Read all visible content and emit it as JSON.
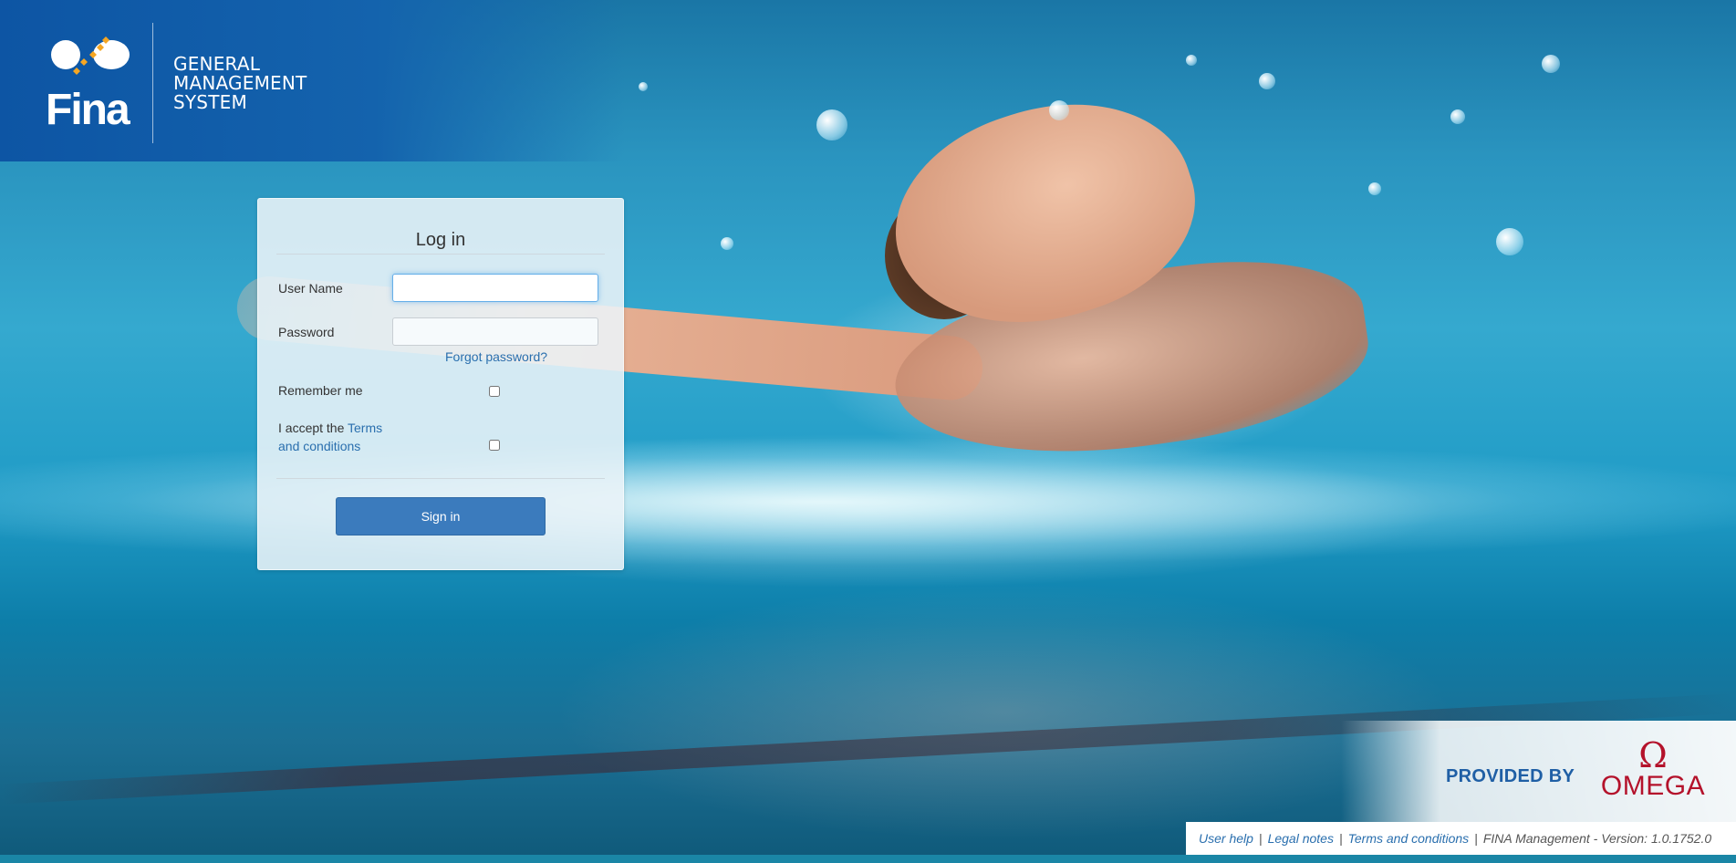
{
  "header": {
    "logo_text": "Fina",
    "title_lines": [
      "GENERAL",
      "MANAGEMENT",
      "SYSTEM"
    ],
    "brand_color": "#0d55a4"
  },
  "login": {
    "title": "Log in",
    "username_label": "User Name",
    "username_value": "",
    "password_label": "Password",
    "password_value": "",
    "forgot_link": "Forgot password?",
    "remember_label": "Remember me",
    "remember_checked": false,
    "accept_prefix": "I accept the ",
    "accept_link": "Terms and conditions",
    "accept_checked": false,
    "signin_label": "Sign in",
    "button_color": "#3b7bbd"
  },
  "sponsor": {
    "provided_by": "PROVIDED BY",
    "omega_symbol": "Ω",
    "omega_word": "OMEGA",
    "omega_color": "#b4122b"
  },
  "footer": {
    "user_help": "User help",
    "legal_notes": "Legal notes",
    "terms": "Terms and conditions",
    "separator": "|",
    "version_text": "FINA Management - Version: 1.0.1752.0"
  }
}
